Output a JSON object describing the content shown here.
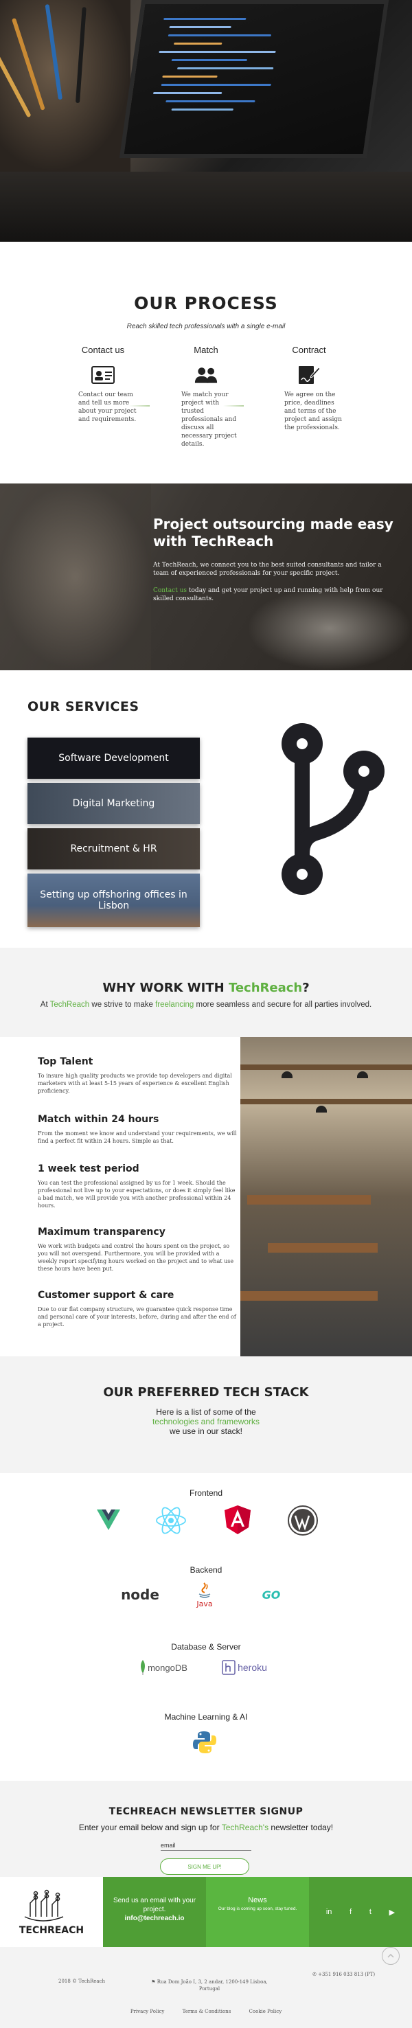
{
  "process": {
    "title": "OUR PROCESS",
    "subtitle": "Reach skilled tech professionals with a single e-mail",
    "steps": [
      {
        "title": "Contact us",
        "icon": "id-card-icon",
        "description": "Contact our team and tell us more about your project and requirements."
      },
      {
        "title": "Match",
        "icon": "users-icon",
        "description": "We match your project with trusted professionals and discuss all necessary project details."
      },
      {
        "title": "Contract",
        "icon": "contract-sign-icon",
        "description": "We agree on the price, deadlines and terms of the project and assign the professionals."
      }
    ]
  },
  "outsourcing": {
    "title": "Project outsourcing made easy with TechReach",
    "paragraph1": "At TechReach, we connect you to the best suited consultants and tailor a team of experienced professionals for your specific project.",
    "paragraph2_link": "Contact us",
    "paragraph2_rest": " today and get your project up and running with help from our skilled consultants."
  },
  "services": {
    "title": "OUR SERVICES",
    "items": [
      {
        "label": "Software Development",
        "bg": "#15161c"
      },
      {
        "label": "Digital Marketing",
        "bg": "#3f4a58"
      },
      {
        "label": "Recruitment & HR",
        "bg": "#3a3530"
      },
      {
        "label": "Setting up offshoring offices in Lisbon",
        "bg": "#50607a"
      }
    ],
    "icon": "git-branch-icon"
  },
  "why": {
    "title_prefix": "WHY WORK WITH ",
    "title_brand": "TechReach",
    "title_suffix": "?",
    "tag_at": "At ",
    "tag_brand": "TechReach",
    "tag_mid": " we strive to make ",
    "tag_freelancing": "freelancing",
    "tag_end": " more seamless and secure for all parties involved."
  },
  "features": [
    {
      "title": "Top Talent",
      "description": "To insure high quality products we provide top developers and digital marketers with at least 5-15 years of experience & excellent English proficiency."
    },
    {
      "title": "Match within 24 hours",
      "description": "From the moment we know and understand your requirements, we will find a perfect fit within 24 hours. Simple as that."
    },
    {
      "title": "1 week test period",
      "description": "You can test the professional assigned by us for 1 week. Should the professional not live up to your expectations, or does it simply feel like a bad match, we will provide you with another professional within 24 hours."
    },
    {
      "title": "Maximum transparency",
      "description": "We work with budgets and control the hours spent on the project, so you will not overspend. Furthermore, you will be provided with a weekly report specifying hours worked on the project and to what use these hours have been put."
    },
    {
      "title": "Customer support & care",
      "description": "Due to our flat company structure, we guarantee quick response time and personal care of your interests, before, during and after the end of a project."
    }
  ],
  "stack": {
    "title": "OUR PREFERRED TECH STACK",
    "intro_line1": "Here is a list of some of the",
    "intro_highlight": "technologies and frameworks",
    "intro_line3": "we use in our stack!",
    "categories": [
      {
        "name": "Frontend",
        "logos": [
          "vue-logo-icon",
          "react-logo-icon",
          "angular-logo-icon",
          "wordpress-logo-icon"
        ]
      },
      {
        "name": "Backend",
        "logos": [
          "nodejs-logo-icon",
          "java-logo-icon",
          "go-logo-icon"
        ]
      },
      {
        "name": "Database & Server",
        "logos": [
          "mongodb-logo-icon",
          "heroku-logo-icon"
        ]
      },
      {
        "name": "Machine Learning & AI",
        "logos": [
          "python-logo-icon"
        ]
      }
    ],
    "node_text": "node",
    "java_text": "Java",
    "go_text": "GO",
    "mongo_text": "mongoDB",
    "heroku_text": "heroku"
  },
  "newsletter": {
    "title": "TECHREACH NEWSLETTER SIGNUP",
    "text_prefix": "Enter your email below and sign up for ",
    "text_brand": "TechReach's",
    "text_suffix": " newsletter today!",
    "email_label": "email",
    "button": "SIGN ME UP!"
  },
  "footer": {
    "logo_text": "TECHREACH",
    "contact_line1": "Send us an email with your project.",
    "contact_email": "info@techreach.io",
    "news_title": "News",
    "news_desc": "Our blog is coming up soon, stay tuned.",
    "social": [
      {
        "label": "in",
        "icon": "linkedin-icon"
      },
      {
        "label": "f",
        "icon": "facebook-icon"
      },
      {
        "label": "t",
        "icon": "twitter-icon"
      },
      {
        "label": "▶",
        "icon": "youtube-icon"
      }
    ]
  },
  "bottom": {
    "copyright": "2018 © TechReach",
    "address": "Rua Dom João I, 3, 2 andar, 1200-149 Lisboa, Portugal",
    "phone": "+351 916 033 813 (PT)",
    "links": [
      "Privacy Policy",
      "Terms & Conditions",
      "Cookie Policy"
    ]
  }
}
